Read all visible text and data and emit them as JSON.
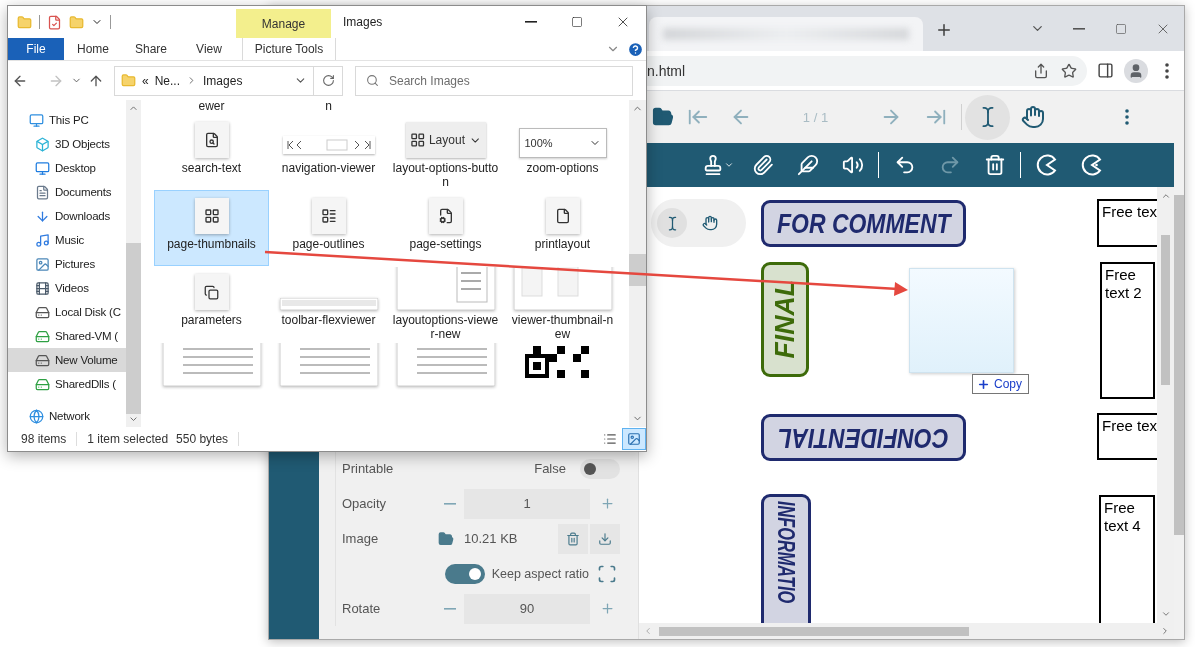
{
  "explorer": {
    "context_tab": "Manage",
    "title": "Images",
    "ribbon_tabs": [
      {
        "label": "File",
        "kind": "file"
      },
      {
        "label": "Home",
        "kind": "tab"
      },
      {
        "label": "Share",
        "kind": "tab"
      },
      {
        "label": "View",
        "kind": "tab"
      },
      {
        "label": "Picture Tools",
        "kind": "context"
      }
    ],
    "address": {
      "overflow": "«",
      "segments": [
        "Ne...",
        "Images"
      ]
    },
    "search": {
      "placeholder": "Search Images"
    },
    "nav_pane": {
      "items": [
        {
          "label": "This PC",
          "kind": "pc",
          "selected": false,
          "children": [
            {
              "label": "3D Objects",
              "kind": "objects",
              "selected": false
            },
            {
              "label": "Desktop",
              "kind": "desktop",
              "selected": false
            },
            {
              "label": "Documents",
              "kind": "documents",
              "selected": false
            },
            {
              "label": "Downloads",
              "kind": "downloads",
              "selected": false
            },
            {
              "label": "Music",
              "kind": "music",
              "selected": false
            },
            {
              "label": "Pictures",
              "kind": "pictures",
              "selected": false
            },
            {
              "label": "Videos",
              "kind": "videos",
              "selected": false
            },
            {
              "label": "Local Disk (C",
              "kind": "disk",
              "selected": false
            },
            {
              "label": "Shared-VM (",
              "kind": "net-drive",
              "selected": false
            },
            {
              "label": "New Volume",
              "kind": "disk",
              "selected": true
            },
            {
              "label": "SharedDlls (",
              "kind": "net-drive",
              "selected": false
            }
          ]
        },
        {
          "label": "Network",
          "kind": "network",
          "selected": false
        }
      ]
    },
    "files": {
      "cut_labels": [
        "ewer",
        "n"
      ],
      "items": [
        {
          "name": "search-text",
          "kind": "search-doc",
          "selected": false
        },
        {
          "name": "navigation-viewer",
          "kind": "pager",
          "selected": false
        },
        {
          "name": "layout-options-button",
          "kind": "layout-button",
          "thumb_text": "Layout",
          "selected": false
        },
        {
          "name": "zoom-options",
          "kind": "zoom-select",
          "thumb_text": "100%",
          "selected": false
        },
        {
          "name": "page-thumbnails",
          "kind": "grid",
          "selected": true
        },
        {
          "name": "page-outlines",
          "kind": "outline",
          "selected": false
        },
        {
          "name": "page-settings",
          "kind": "doc-settings",
          "selected": false
        },
        {
          "name": "printlayout",
          "kind": "doc",
          "selected": false
        },
        {
          "name": "parameters",
          "kind": "copies",
          "selected": false
        },
        {
          "name": "toolbar-flexviewer",
          "kind": "toolbar-shot",
          "selected": false
        },
        {
          "name": "layoutoptions-viewer-new",
          "kind": "menu-shot",
          "selected": false
        },
        {
          "name": "viewer-thumbnail-new",
          "kind": "viewer-shot",
          "selected": false
        },
        {
          "kind": "table-shot",
          "selected": false
        },
        {
          "kind": "table-shot",
          "selected": false
        },
        {
          "kind": "form-shot",
          "selected": false
        },
        {
          "kind": "qr",
          "selected": false
        }
      ]
    },
    "status_bar": {
      "count": "98 items",
      "selection": "1 item selected",
      "size": "550 bytes"
    },
    "views": [
      {
        "kind": "details",
        "selected": false
      },
      {
        "kind": "large-icons",
        "selected": true
      }
    ]
  },
  "browser": {
    "address": "n.html",
    "viewer": {
      "navigation": {
        "page": "1 / 1",
        "disabled": true
      },
      "modes": [
        {
          "kind": "text-select",
          "selected": true
        },
        {
          "kind": "pan",
          "selected": false
        }
      ]
    },
    "annotation_tools": {
      "redo_disabled": true
    },
    "mode_pill": [
      {
        "kind": "text-select",
        "selected": true
      },
      {
        "kind": "pan",
        "selected": false
      }
    ],
    "properties": [
      {
        "kind": "switch",
        "label": "Printable",
        "value": "False",
        "on": false
      },
      {
        "kind": "stepper",
        "label": "Opacity",
        "value": "1"
      },
      {
        "kind": "image",
        "label": "Image",
        "value": "10.21 KB"
      },
      {
        "kind": "toggle",
        "label": "Keep aspect ratio",
        "on": true
      },
      {
        "kind": "stepper",
        "label": "Rotate",
        "value": "90"
      }
    ],
    "stamps": [
      {
        "text": "FOR COMMENT",
        "kind": "horizontal",
        "color": "#1f2a6e"
      },
      {
        "text": "FINAL",
        "kind": "vertical-up",
        "color": "#3d6b0a"
      },
      {
        "text": "CONFIDENTIAL",
        "kind": "upside-down",
        "color": "#1f2a6e"
      },
      {
        "text": "INFORMATIO",
        "kind": "vertical-down",
        "color": "#1f2a6e"
      }
    ],
    "free_texts": [
      "Free tex",
      "Free text 2",
      "Free tex",
      "Free text 4"
    ],
    "drag": {
      "label": "Copy"
    }
  }
}
